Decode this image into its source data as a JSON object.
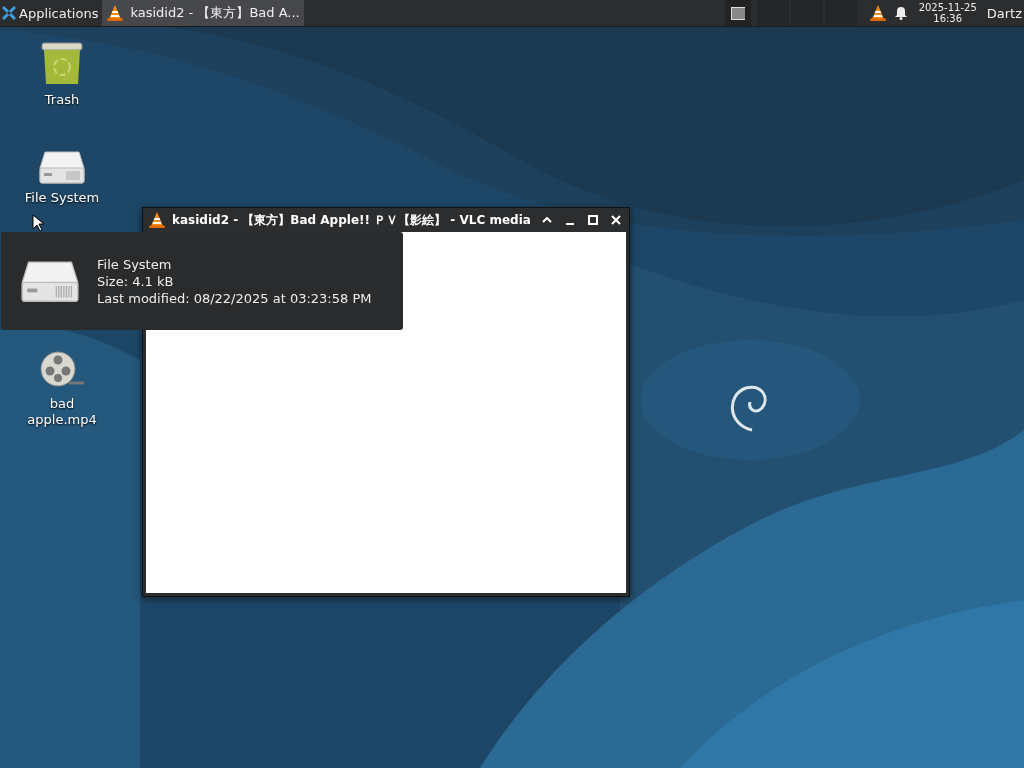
{
  "taskbar": {
    "menu_label": "Applications",
    "tasks": [
      {
        "label": "kasidid2 - 【東方】Bad A...",
        "selected": true
      }
    ],
    "clock": {
      "date": "2025-11-25",
      "time": "16:36"
    },
    "user": "Dartz"
  },
  "desktop_icons": [
    {
      "label": "Trash",
      "kind": "trash"
    },
    {
      "label": "File System",
      "kind": "drive"
    },
    {
      "label": "bad apple.mp4",
      "kind": "video"
    }
  ],
  "window": {
    "title": "kasidid2 - 【東方】Bad Apple!! ＰＶ【影絵】 - VLC media"
  },
  "tooltip": {
    "lines": [
      "File System",
      "Size: 4.1 kB",
      "Last modified: 08/22/2025 at 03:23:58 PM"
    ]
  }
}
